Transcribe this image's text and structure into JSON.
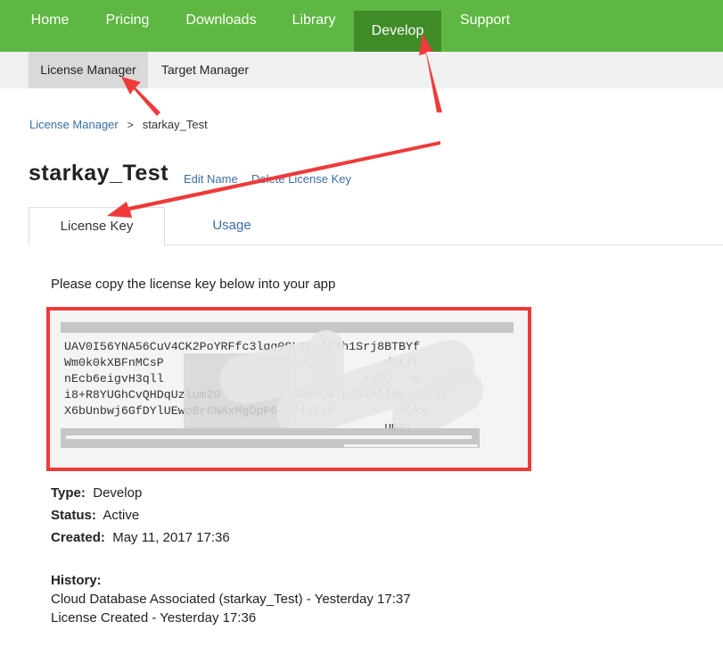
{
  "nav": {
    "items": [
      {
        "label": "Home",
        "active": false
      },
      {
        "label": "Pricing",
        "active": false
      },
      {
        "label": "Downloads",
        "active": false
      },
      {
        "label": "Library",
        "active": false
      },
      {
        "label": "Develop",
        "active": true
      },
      {
        "label": "Support",
        "active": false
      }
    ]
  },
  "subnav": {
    "items": [
      {
        "label": "License Manager",
        "active": true
      },
      {
        "label": "Target Manager",
        "active": false
      }
    ]
  },
  "breadcrumb": {
    "parent": "License Manager",
    "separator": ">",
    "current": "starkay_Test"
  },
  "page": {
    "title": "starkay_Test",
    "edit_name": "Edit Name",
    "delete_key": "Delete License Key"
  },
  "tabs": [
    {
      "label": "License Key",
      "active": true
    },
    {
      "label": "Usage",
      "active": false
    }
  ],
  "license": {
    "instruction": "Please copy the license key below into your app",
    "key_lines": [
      "UAV0I56YNA56CuV4CK2PoYRFfc3lqg0SLIHo7E4h1Srj8BTBYf",
      "Wm0k0kXBFnMCsP                 UtJkcWh       dStfr",
      "nEcb6eigvH3qll              ZS            saDQ   c",
      "i8+R8YUGhCvQHDqUzlum20          xwuhQw7pZ3XH5ZnH    T1",
      "X6bUnbwj6GfDYlUEwoBr6NAxMgDpP6qYPintqN         +OkW",
      "                                             umx1"
    ]
  },
  "details": {
    "type_label": "Type:",
    "type_value": "Develop",
    "status_label": "Status:",
    "status_value": "Active",
    "created_label": "Created:",
    "created_value": "May 11, 2017 17:36"
  },
  "history": {
    "label": "History:",
    "entries": [
      "Cloud Database Associated (starkay_Test) - Yesterday 17:37",
      "License Created - Yesterday 17:36"
    ]
  },
  "colors": {
    "nav_bg": "#5eb742",
    "nav_active_bg": "#3f8b28",
    "link": "#3a6ea5",
    "highlight_border": "#ef3a3a",
    "annotation_arrow": "#ef3a3a"
  }
}
